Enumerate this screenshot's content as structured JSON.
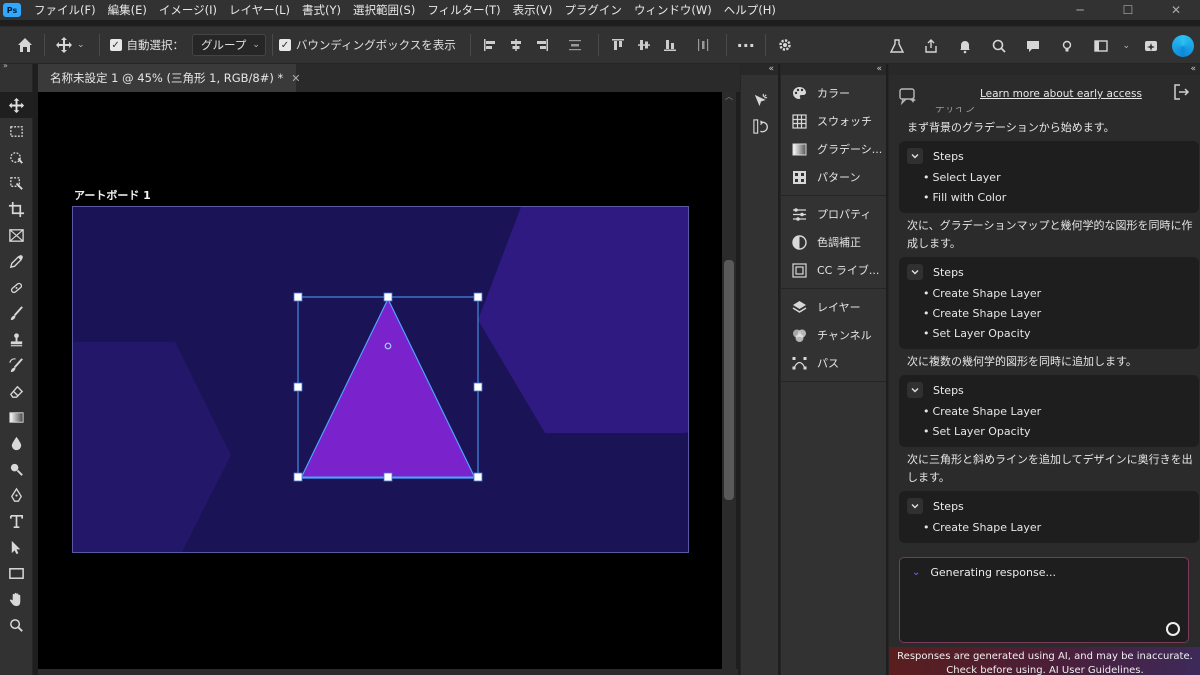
{
  "app": {
    "menus": [
      "ファイル(F)",
      "編集(E)",
      "イメージ(I)",
      "レイヤー(L)",
      "書式(Y)",
      "選択範囲(S)",
      "フィルター(T)",
      "表示(V)",
      "プラグイン",
      "ウィンドウ(W)",
      "ヘルプ(H)"
    ],
    "logo_text": "Ps"
  },
  "options_bar": {
    "auto_select_label": "自動選択：",
    "auto_select_checked": true,
    "auto_select_target": "グループ",
    "bounding_box_label": "バウンディングボックスを表示",
    "bounding_box_checked": true
  },
  "document": {
    "tab_title": "名称未設定 1 @ 45% (三角形 1, RGB/8#) *",
    "artboard_name": "アートボード 1",
    "selected_layer": "三角形 1",
    "zoom": "45%",
    "mode": "RGB/8#"
  },
  "panels": {
    "group1": [
      "カラー",
      "スウォッチ",
      "グラデーシ...",
      "パターン"
    ],
    "group2": [
      "プロパティ",
      "色調補正",
      "CC ライブ..."
    ],
    "group3": [
      "レイヤー",
      "チャンネル",
      "パス"
    ]
  },
  "ai_assistant": {
    "learn_more": "Learn more about early access",
    "cut_text": "デザイン",
    "steps_heading": "Steps",
    "blocks": [
      {
        "text": "まず背景のグラデーションから始めます。",
        "steps": [
          "Select Layer",
          "Fill with Color"
        ]
      },
      {
        "text": "次に、グラデーションマップと幾何学的な図形を同時に作成します。",
        "steps": [
          "Create Shape Layer",
          "Create Shape Layer",
          "Set Layer Opacity"
        ]
      },
      {
        "text": "次に複数の幾何学的図形を同時に追加します。",
        "steps": [
          "Create Shape Layer",
          "Set Layer Opacity"
        ]
      },
      {
        "text": "次に三角形と斜めラインを追加してデザインに奥行きを出します。",
        "steps": [
          "Create Shape Layer"
        ]
      }
    ],
    "generating": "Generating response...",
    "footer": "Responses are generated using AI, and may be inaccurate. Check before using. AI User Guidelines."
  },
  "colors": {
    "artboard_bg": "#1a1356",
    "shape_dark": "#23176a",
    "shape_purple": "#2e1a80",
    "triangle_fill": "#7a22cc",
    "selection": "#4da3ff",
    "accent_blue": "#31a8ff"
  }
}
